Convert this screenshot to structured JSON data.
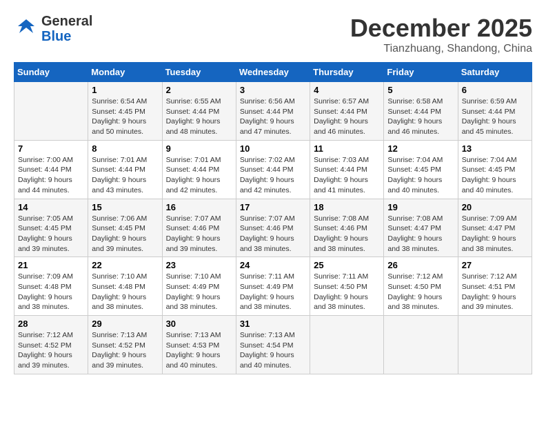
{
  "header": {
    "logo_line1": "General",
    "logo_line2": "Blue",
    "title": "December 2025",
    "subtitle": "Tianzhuang, Shandong, China"
  },
  "weekdays": [
    "Sunday",
    "Monday",
    "Tuesday",
    "Wednesday",
    "Thursday",
    "Friday",
    "Saturday"
  ],
  "weeks": [
    [
      {
        "day": "",
        "info": ""
      },
      {
        "day": "1",
        "info": "Sunrise: 6:54 AM\nSunset: 4:45 PM\nDaylight: 9 hours\nand 50 minutes."
      },
      {
        "day": "2",
        "info": "Sunrise: 6:55 AM\nSunset: 4:44 PM\nDaylight: 9 hours\nand 48 minutes."
      },
      {
        "day": "3",
        "info": "Sunrise: 6:56 AM\nSunset: 4:44 PM\nDaylight: 9 hours\nand 47 minutes."
      },
      {
        "day": "4",
        "info": "Sunrise: 6:57 AM\nSunset: 4:44 PM\nDaylight: 9 hours\nand 46 minutes."
      },
      {
        "day": "5",
        "info": "Sunrise: 6:58 AM\nSunset: 4:44 PM\nDaylight: 9 hours\nand 46 minutes."
      },
      {
        "day": "6",
        "info": "Sunrise: 6:59 AM\nSunset: 4:44 PM\nDaylight: 9 hours\nand 45 minutes."
      }
    ],
    [
      {
        "day": "7",
        "info": "Sunrise: 7:00 AM\nSunset: 4:44 PM\nDaylight: 9 hours\nand 44 minutes."
      },
      {
        "day": "8",
        "info": "Sunrise: 7:01 AM\nSunset: 4:44 PM\nDaylight: 9 hours\nand 43 minutes."
      },
      {
        "day": "9",
        "info": "Sunrise: 7:01 AM\nSunset: 4:44 PM\nDaylight: 9 hours\nand 42 minutes."
      },
      {
        "day": "10",
        "info": "Sunrise: 7:02 AM\nSunset: 4:44 PM\nDaylight: 9 hours\nand 42 minutes."
      },
      {
        "day": "11",
        "info": "Sunrise: 7:03 AM\nSunset: 4:44 PM\nDaylight: 9 hours\nand 41 minutes."
      },
      {
        "day": "12",
        "info": "Sunrise: 7:04 AM\nSunset: 4:45 PM\nDaylight: 9 hours\nand 40 minutes."
      },
      {
        "day": "13",
        "info": "Sunrise: 7:04 AM\nSunset: 4:45 PM\nDaylight: 9 hours\nand 40 minutes."
      }
    ],
    [
      {
        "day": "14",
        "info": "Sunrise: 7:05 AM\nSunset: 4:45 PM\nDaylight: 9 hours\nand 39 minutes."
      },
      {
        "day": "15",
        "info": "Sunrise: 7:06 AM\nSunset: 4:45 PM\nDaylight: 9 hours\nand 39 minutes."
      },
      {
        "day": "16",
        "info": "Sunrise: 7:07 AM\nSunset: 4:46 PM\nDaylight: 9 hours\nand 39 minutes."
      },
      {
        "day": "17",
        "info": "Sunrise: 7:07 AM\nSunset: 4:46 PM\nDaylight: 9 hours\nand 38 minutes."
      },
      {
        "day": "18",
        "info": "Sunrise: 7:08 AM\nSunset: 4:46 PM\nDaylight: 9 hours\nand 38 minutes."
      },
      {
        "day": "19",
        "info": "Sunrise: 7:08 AM\nSunset: 4:47 PM\nDaylight: 9 hours\nand 38 minutes."
      },
      {
        "day": "20",
        "info": "Sunrise: 7:09 AM\nSunset: 4:47 PM\nDaylight: 9 hours\nand 38 minutes."
      }
    ],
    [
      {
        "day": "21",
        "info": "Sunrise: 7:09 AM\nSunset: 4:48 PM\nDaylight: 9 hours\nand 38 minutes."
      },
      {
        "day": "22",
        "info": "Sunrise: 7:10 AM\nSunset: 4:48 PM\nDaylight: 9 hours\nand 38 minutes."
      },
      {
        "day": "23",
        "info": "Sunrise: 7:10 AM\nSunset: 4:49 PM\nDaylight: 9 hours\nand 38 minutes."
      },
      {
        "day": "24",
        "info": "Sunrise: 7:11 AM\nSunset: 4:49 PM\nDaylight: 9 hours\nand 38 minutes."
      },
      {
        "day": "25",
        "info": "Sunrise: 7:11 AM\nSunset: 4:50 PM\nDaylight: 9 hours\nand 38 minutes."
      },
      {
        "day": "26",
        "info": "Sunrise: 7:12 AM\nSunset: 4:50 PM\nDaylight: 9 hours\nand 38 minutes."
      },
      {
        "day": "27",
        "info": "Sunrise: 7:12 AM\nSunset: 4:51 PM\nDaylight: 9 hours\nand 39 minutes."
      }
    ],
    [
      {
        "day": "28",
        "info": "Sunrise: 7:12 AM\nSunset: 4:52 PM\nDaylight: 9 hours\nand 39 minutes."
      },
      {
        "day": "29",
        "info": "Sunrise: 7:13 AM\nSunset: 4:52 PM\nDaylight: 9 hours\nand 39 minutes."
      },
      {
        "day": "30",
        "info": "Sunrise: 7:13 AM\nSunset: 4:53 PM\nDaylight: 9 hours\nand 40 minutes."
      },
      {
        "day": "31",
        "info": "Sunrise: 7:13 AM\nSunset: 4:54 PM\nDaylight: 9 hours\nand 40 minutes."
      },
      {
        "day": "",
        "info": ""
      },
      {
        "day": "",
        "info": ""
      },
      {
        "day": "",
        "info": ""
      }
    ]
  ]
}
